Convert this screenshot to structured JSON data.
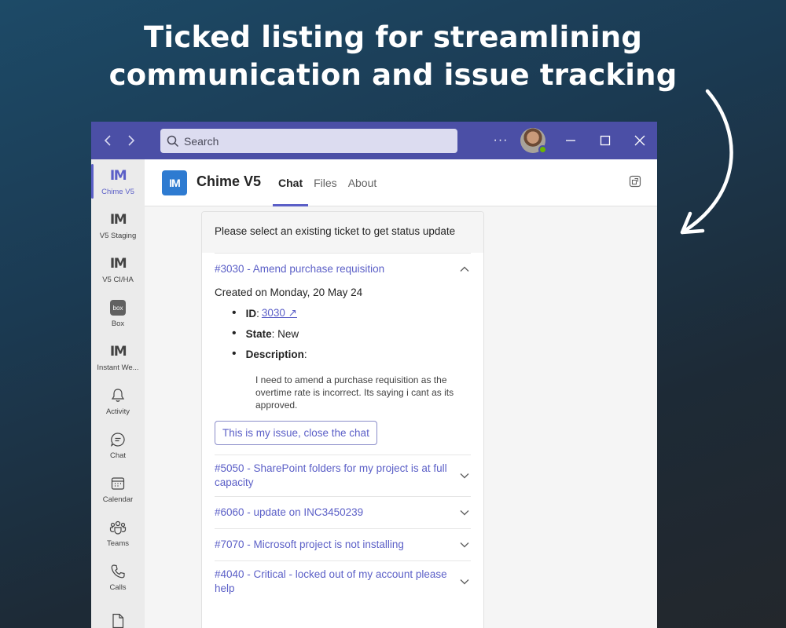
{
  "headline": {
    "line1": "Ticked listing for streamlining",
    "line2": "communication and issue tracking"
  },
  "titlebar": {
    "back_icon": "chevron-left-icon",
    "forward_icon": "chevron-right-icon",
    "search_placeholder": "Search",
    "more_label": "···",
    "presence_color": "#6bb700"
  },
  "rail": {
    "items": [
      {
        "label": "Chime V5",
        "icon": "IM",
        "active": true
      },
      {
        "label": "V5 Staging",
        "icon": "IM"
      },
      {
        "label": "V5 CI/HA",
        "icon": "IM"
      },
      {
        "label": "Box",
        "icon": "box"
      },
      {
        "label": "Instant We...",
        "icon": "IM"
      },
      {
        "label": "Activity",
        "icon": "bell-icon"
      },
      {
        "label": "Chat",
        "icon": "chat-icon"
      },
      {
        "label": "Calendar",
        "icon": "calendar-icon"
      },
      {
        "label": "Teams",
        "icon": "teams-icon"
      },
      {
        "label": "Calls",
        "icon": "phone-icon"
      }
    ]
  },
  "header": {
    "logo_text": "IM",
    "app_name": "Chime V5",
    "tabs": [
      "Chat",
      "Files",
      "About"
    ],
    "active_tab": "Chat"
  },
  "card": {
    "prompt": "Please select an existing ticket to get status update",
    "expanded": {
      "title": "#3030 - Amend purchase requisition",
      "created": "Created on Monday, 20 May 24",
      "id_label": "ID",
      "id_value": "3030 ↗",
      "state_label": "State",
      "state_value": "New",
      "description_label": "Description",
      "description_text": "I need to amend a purchase requisition as the overtime rate is incorrect. Its saying i cant as its approved.",
      "close_button": "This is my issue, close the chat"
    },
    "collapsed": [
      "#5050 - SharePoint folders for my project is at full capacity",
      "#6060 - update on INC3450239",
      "#7070 - Microsoft project is not installing",
      "#4040 - Critical - locked out of my account please help"
    ]
  },
  "colors": {
    "titlebar": "#4b4fa6",
    "accent": "#5b5fc7",
    "app_logo": "#2e7bd1"
  }
}
